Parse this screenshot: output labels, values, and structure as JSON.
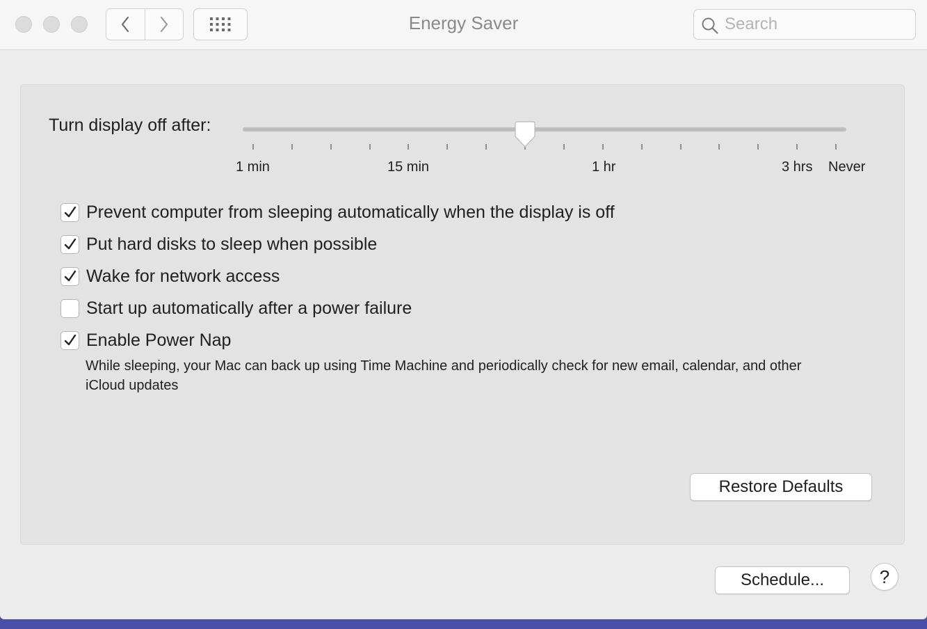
{
  "window": {
    "title": "Energy Saver"
  },
  "toolbar": {
    "back_icon": "chevron-left-icon",
    "forward_icon": "chevron-right-icon",
    "grid_icon": "grid-icon",
    "search_placeholder": "Search",
    "search_value": ""
  },
  "display_sleep": {
    "label": "Turn display off after:",
    "tick_labels": [
      "1 min",
      "15 min",
      "1 hr",
      "3 hrs",
      "Never"
    ],
    "current_value": "30 min"
  },
  "options": [
    {
      "label": "Prevent computer from sleeping automatically when the display is off",
      "checked": true
    },
    {
      "label": "Put hard disks to sleep when possible",
      "checked": true
    },
    {
      "label": "Wake for network access",
      "checked": true
    },
    {
      "label": "Start up automatically after a power failure",
      "checked": false
    },
    {
      "label": "Enable Power Nap",
      "checked": true
    }
  ],
  "power_nap_description": "While sleeping, your Mac can back up using Time Machine and periodically check for new email, calendar, and other iCloud updates",
  "buttons": {
    "restore_defaults": "Restore Defaults",
    "schedule": "Schedule...",
    "help": "?"
  }
}
